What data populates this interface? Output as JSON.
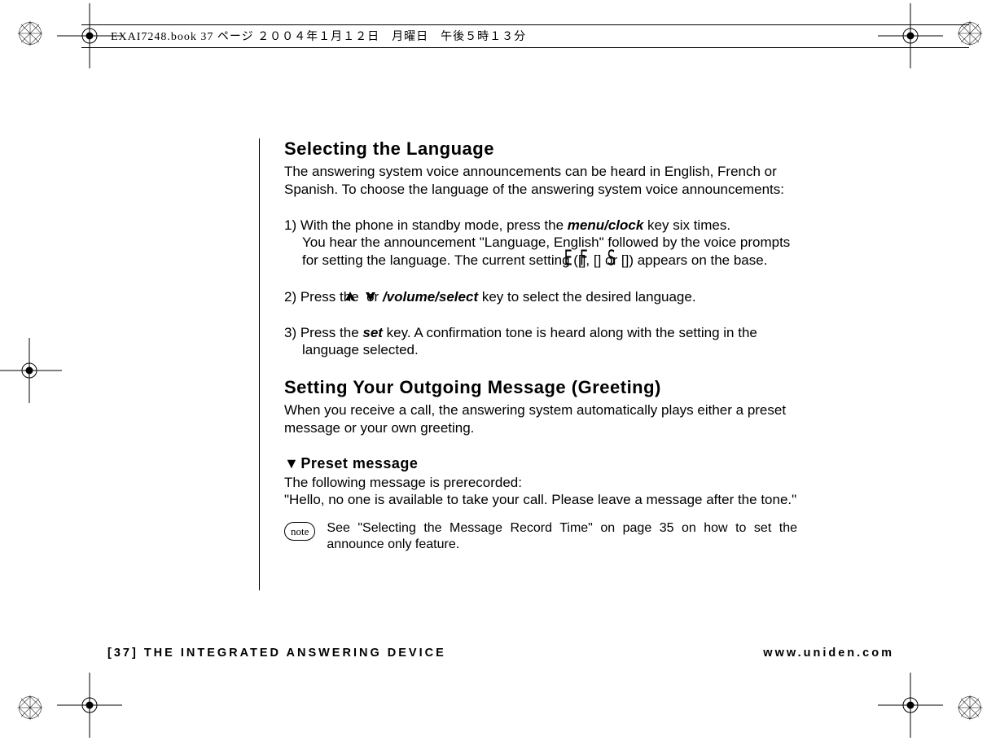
{
  "print_header": "EXAI7248.book  37 ページ  ２００４年１月１２日　月曜日　午後５時１３分",
  "sec1": {
    "title": "Selecting the Language",
    "intro": "The answering system voice announcements can be heard in English, French or Spanish. To choose the language of the answering system voice announcements:",
    "step1_a": "1) With the phone in standby mode, press the ",
    "step1_menu": "menu/clock",
    "step1_b": " key six times.\nYou hear the announcement \"Language, English\" followed by the voice prompts for setting the language. The current setting ([",
    "step1_e": "E",
    "step1_c": "], [",
    "step1_f": "F",
    "step1_d": "] or [",
    "step1_s": "S",
    "step1_e2": "]) appears on the base.",
    "step2_a": "2) Press the ",
    "step2_or": " or ",
    "step2_vol": "/volume/select",
    "step2_b": " key to select the desired language.",
    "step3_a": "3) Press the ",
    "step3_set": "set",
    "step3_b": " key. A confirmation tone is heard along with the setting in the language selected."
  },
  "sec2": {
    "title": "Setting Your Outgoing Message (Greeting)",
    "intro": "When you receive a call, the answering system automatically plays either a preset message or your own greeting.",
    "preset_heading": "Preset message",
    "preset_body": "The following message is prerecorded:\n\"Hello, no one is available to take your call. Please leave a message after the tone.\"",
    "note_label": "note",
    "note_text": "See \"Selecting the Message Record Time\" on page 35 on how to set the announce only feature."
  },
  "footer": {
    "left": "[37] THE INTEGRATED ANSWERING DEVICE",
    "right": "www.uniden.com"
  }
}
